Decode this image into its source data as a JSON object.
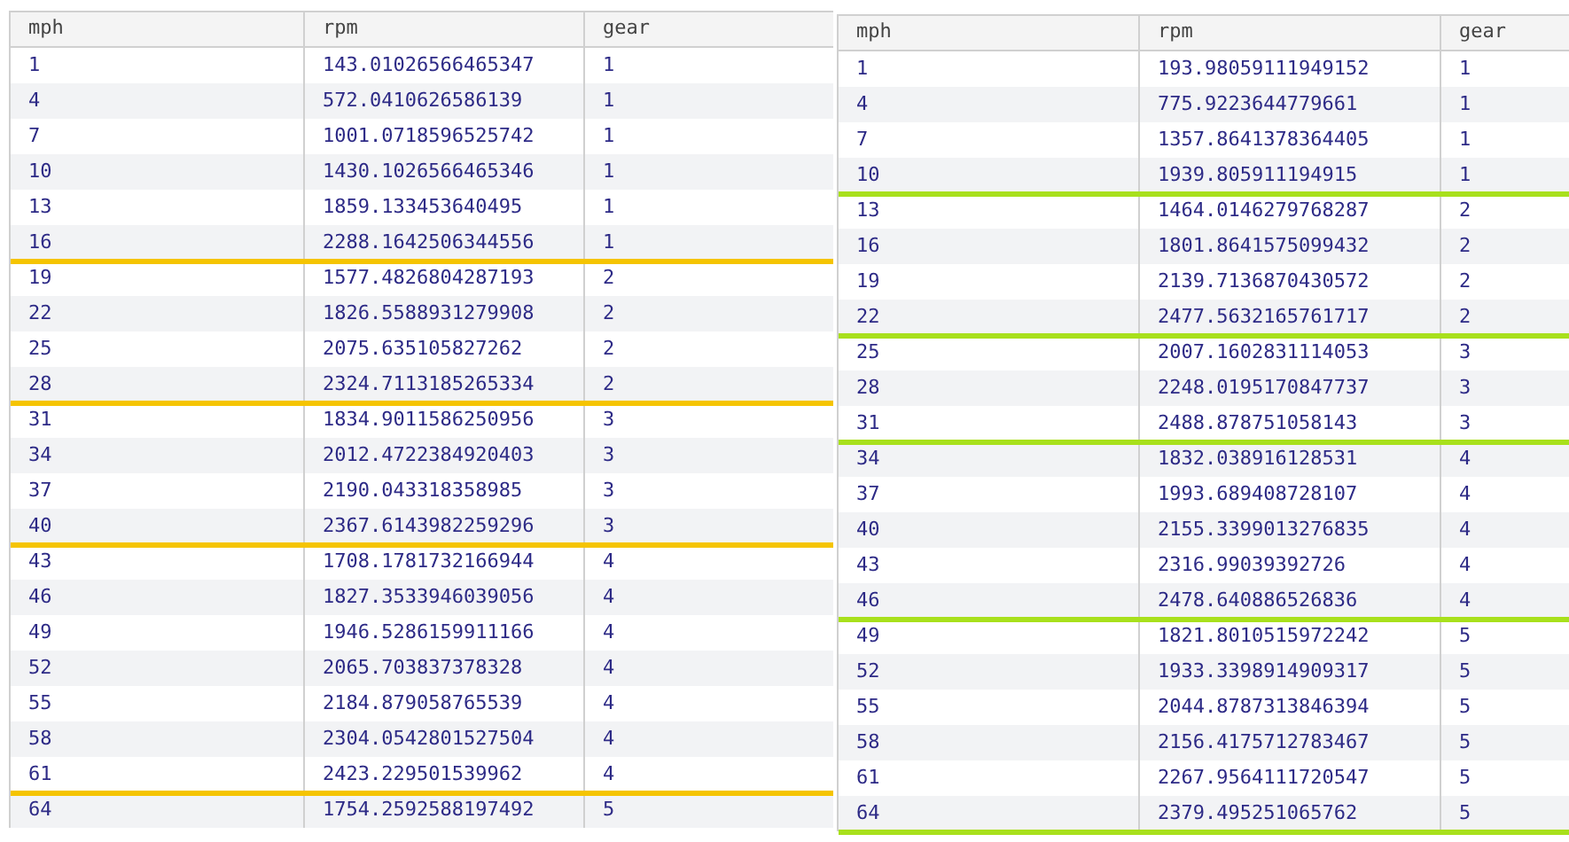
{
  "tables": [
    {
      "color": "#f5c400",
      "columns": [
        "mph",
        "rpm",
        "gear"
      ],
      "rows": [
        {
          "cells": [
            "1",
            "143.01026566465347",
            "1"
          ],
          "marked": false
        },
        {
          "cells": [
            "4",
            "572.0410626586139",
            "1"
          ],
          "marked": false
        },
        {
          "cells": [
            "7",
            "1001.0718596525742",
            "1"
          ],
          "marked": false
        },
        {
          "cells": [
            "10",
            "1430.1026566465346",
            "1"
          ],
          "marked": false
        },
        {
          "cells": [
            "13",
            "1859.133453640495",
            "1"
          ],
          "marked": false
        },
        {
          "cells": [
            "16",
            "2288.1642506344556",
            "1"
          ],
          "marked": true
        },
        {
          "cells": [
            "19",
            "1577.4826804287193",
            "2"
          ],
          "marked": false
        },
        {
          "cells": [
            "22",
            "1826.5588931279908",
            "2"
          ],
          "marked": false
        },
        {
          "cells": [
            "25",
            "2075.635105827262",
            "2"
          ],
          "marked": false
        },
        {
          "cells": [
            "28",
            "2324.7113185265334",
            "2"
          ],
          "marked": true
        },
        {
          "cells": [
            "31",
            "1834.9011586250956",
            "3"
          ],
          "marked": false
        },
        {
          "cells": [
            "34",
            "2012.4722384920403",
            "3"
          ],
          "marked": false
        },
        {
          "cells": [
            "37",
            "2190.043318358985",
            "3"
          ],
          "marked": false
        },
        {
          "cells": [
            "40",
            "2367.6143982259296",
            "3"
          ],
          "marked": true
        },
        {
          "cells": [
            "43",
            "1708.1781732166944",
            "4"
          ],
          "marked": false
        },
        {
          "cells": [
            "46",
            "1827.3533946039056",
            "4"
          ],
          "marked": false
        },
        {
          "cells": [
            "49",
            "1946.5286159911166",
            "4"
          ],
          "marked": false
        },
        {
          "cells": [
            "52",
            "2065.703837378328",
            "4"
          ],
          "marked": false
        },
        {
          "cells": [
            "55",
            "2184.879058765539",
            "4"
          ],
          "marked": false
        },
        {
          "cells": [
            "58",
            "2304.0542801527504",
            "4"
          ],
          "marked": false
        },
        {
          "cells": [
            "61",
            "2423.229501539962",
            "4"
          ],
          "marked": true
        },
        {
          "cells": [
            "64",
            "1754.2592588197492",
            "5"
          ],
          "marked": false
        }
      ]
    },
    {
      "color": "#a8e01c",
      "columns": [
        "mph",
        "rpm",
        "gear"
      ],
      "rows": [
        {
          "cells": [
            "1",
            "193.98059111949152",
            "1"
          ],
          "marked": false
        },
        {
          "cells": [
            "4",
            "775.9223644779661",
            "1"
          ],
          "marked": false
        },
        {
          "cells": [
            "7",
            "1357.8641378364405",
            "1"
          ],
          "marked": false
        },
        {
          "cells": [
            "10",
            "1939.805911194915",
            "1"
          ],
          "marked": true
        },
        {
          "cells": [
            "13",
            "1464.0146279768287",
            "2"
          ],
          "marked": false
        },
        {
          "cells": [
            "16",
            "1801.8641575099432",
            "2"
          ],
          "marked": false
        },
        {
          "cells": [
            "19",
            "2139.7136870430572",
            "2"
          ],
          "marked": false
        },
        {
          "cells": [
            "22",
            "2477.5632165761717",
            "2"
          ],
          "marked": true
        },
        {
          "cells": [
            "25",
            "2007.1602831114053",
            "3"
          ],
          "marked": false
        },
        {
          "cells": [
            "28",
            "2248.0195170847737",
            "3"
          ],
          "marked": false
        },
        {
          "cells": [
            "31",
            "2488.878751058143",
            "3"
          ],
          "marked": true
        },
        {
          "cells": [
            "34",
            "1832.038916128531",
            "4"
          ],
          "marked": false
        },
        {
          "cells": [
            "37",
            "1993.689408728107",
            "4"
          ],
          "marked": false
        },
        {
          "cells": [
            "40",
            "2155.3399013276835",
            "4"
          ],
          "marked": false
        },
        {
          "cells": [
            "43",
            "2316.99039392726",
            "4"
          ],
          "marked": false
        },
        {
          "cells": [
            "46",
            "2478.640886526836",
            "4"
          ],
          "marked": true
        },
        {
          "cells": [
            "49",
            "1821.8010515972242",
            "5"
          ],
          "marked": false
        },
        {
          "cells": [
            "52",
            "1933.3398914909317",
            "5"
          ],
          "marked": false
        },
        {
          "cells": [
            "55",
            "2044.8787313846394",
            "5"
          ],
          "marked": false
        },
        {
          "cells": [
            "58",
            "2156.4175712783467",
            "5"
          ],
          "marked": false
        },
        {
          "cells": [
            "61",
            "2267.9564111720547",
            "5"
          ],
          "marked": false
        },
        {
          "cells": [
            "64",
            "2379.495251065762",
            "5"
          ],
          "marked": true
        }
      ]
    }
  ]
}
